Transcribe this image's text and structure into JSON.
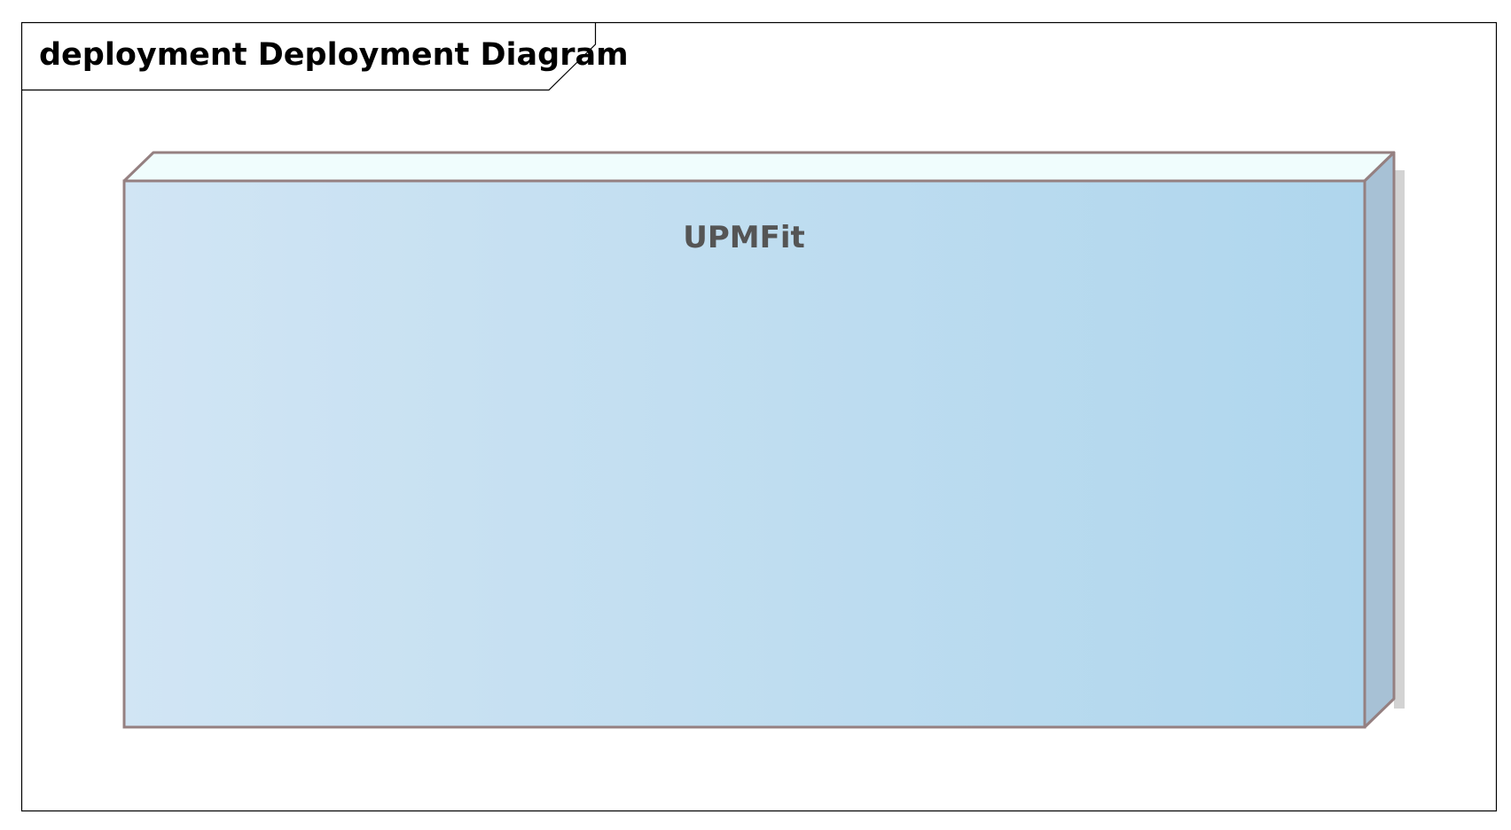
{
  "diagram": {
    "frame": {
      "title": "deployment Deployment Diagram"
    },
    "nodes": [
      {
        "name": "UPMFit"
      }
    ],
    "colors": {
      "border": "#958081",
      "node_fill_left": "#d1e5f4",
      "node_fill_right": "#afd6ed",
      "node_top": "#f0fdfd",
      "node_side": "#a7c1d5",
      "shadow": "#d3d3d3",
      "title_text": "#000000",
      "node_text": "#555555"
    }
  }
}
